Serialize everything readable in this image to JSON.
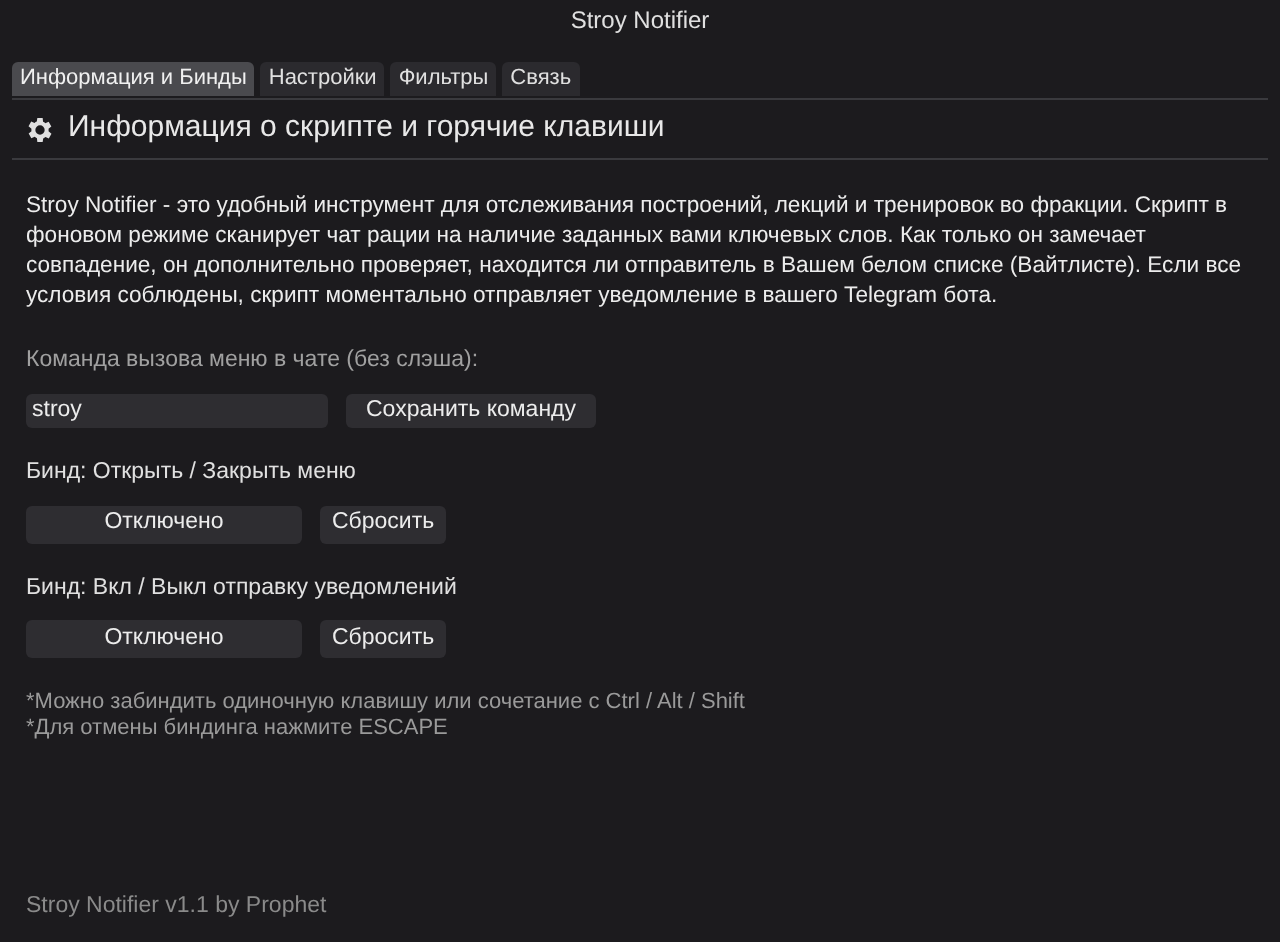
{
  "window": {
    "title": "Stroy Notifier"
  },
  "tabs": [
    {
      "label": "Информация и Бинды",
      "selected": true
    },
    {
      "label": "Настройки",
      "selected": false
    },
    {
      "label": "Фильтры",
      "selected": false
    },
    {
      "label": "Связь",
      "selected": false
    }
  ],
  "section": {
    "title": "Информация о скрипте и горячие клавиши"
  },
  "description": "Stroy Notifier - это удобный инструмент для отслеживания построений, лекций и тренировок во фракции. Скрипт в фоновом режиме сканирует чат рации на наличие заданных вами ключевых слов. Как только он замечает совпадение, он дополнительно проверяет, находится ли отправитель в Вашем белом списке (Вайтлисте). Если все условия соблюдены, скрипт моментально отправляет уведомление в вашего Telegram бота.",
  "command": {
    "label": "Команда вызова меню в чате (без слэша):",
    "value": "stroy",
    "button": "Сохранить команду"
  },
  "binds": [
    {
      "label": "Бинд: Открыть / Закрыть меню",
      "key": "Отключено",
      "reset": "Сбросить"
    },
    {
      "label": "Бинд: Вкл / Выкл отправку уведомлений",
      "key": "Отключено",
      "reset": "Сбросить"
    }
  ],
  "notes": [
    "*Можно забиндить одиночную клавишу или сочетание с Ctrl / Alt / Shift",
    "*Для отмены биндинга нажмите ESCAPE"
  ],
  "footer": "Stroy Notifier v1.1 by Prophet"
}
